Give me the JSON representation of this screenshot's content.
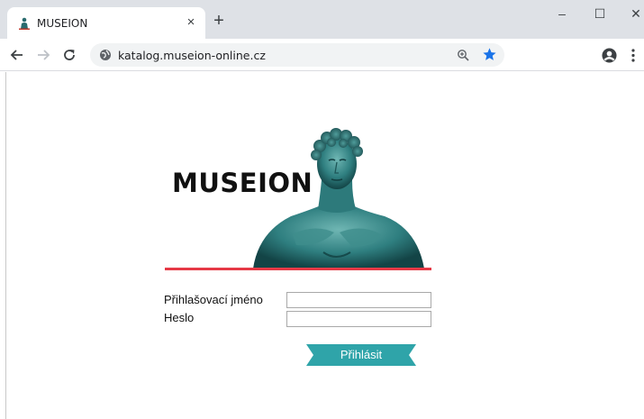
{
  "browser": {
    "tab_title": "MUSEION",
    "tab_close": "×",
    "new_tab": "+",
    "url": "katalog.museion-online.cz",
    "window_min": "–",
    "window_max": "☐",
    "window_close": "✕"
  },
  "icons": {
    "favicon": "museion-statue-icon",
    "site_info": "globe-icon",
    "zoom": "zoom-icon",
    "bookmark": "star-icon",
    "profile": "account-icon",
    "menu": "kebab-menu-icon"
  },
  "logo": {
    "text": "MUSEION"
  },
  "login": {
    "username_label": "Přihlašovací jméno",
    "password_label": "Heslo",
    "username_value": "",
    "password_value": "",
    "submit_label": "Přihlásit"
  },
  "colors": {
    "accent": "#2fa4a9",
    "underline": "#e63946",
    "bookmark_star": "#1a73e8"
  }
}
